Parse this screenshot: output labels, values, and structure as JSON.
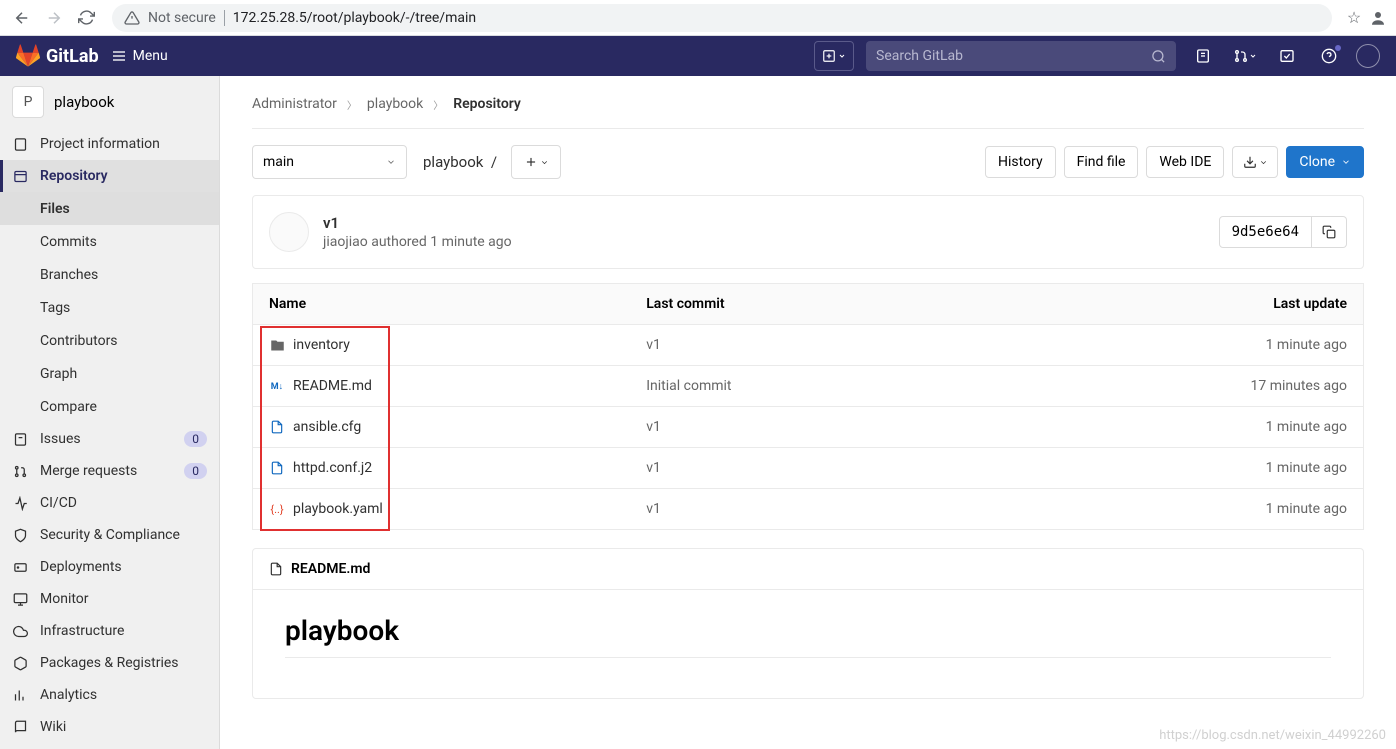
{
  "browser": {
    "not_secure": "Not secure",
    "url": "172.25.28.5/root/playbook/-/tree/main"
  },
  "header": {
    "brand": "GitLab",
    "menu": "Menu",
    "search_placeholder": "Search GitLab"
  },
  "sidebar": {
    "project_letter": "P",
    "project_name": "playbook",
    "items": [
      {
        "label": "Project information"
      },
      {
        "label": "Repository"
      },
      {
        "label": "Issues"
      },
      {
        "label": "Merge requests"
      },
      {
        "label": "CI/CD"
      },
      {
        "label": "Security & Compliance"
      },
      {
        "label": "Deployments"
      },
      {
        "label": "Monitor"
      },
      {
        "label": "Infrastructure"
      },
      {
        "label": "Packages & Registries"
      },
      {
        "label": "Analytics"
      },
      {
        "label": "Wiki"
      }
    ],
    "repo_sub": [
      "Files",
      "Commits",
      "Branches",
      "Tags",
      "Contributors",
      "Graph",
      "Compare"
    ],
    "issues_badge": "0",
    "mr_badge": "0"
  },
  "breadcrumb": {
    "a": "Administrator",
    "b": "playbook",
    "c": "Repository"
  },
  "tree": {
    "branch": "main",
    "path": "playbook",
    "sep": "/",
    "history": "History",
    "find": "Find file",
    "ide": "Web IDE",
    "clone": "Clone"
  },
  "commit": {
    "title": "v1",
    "author": "jiaojiao",
    "action": "authored",
    "time": "1 minute ago",
    "sha": "9d5e6e64"
  },
  "table": {
    "cols": [
      "Name",
      "Last commit",
      "Last update"
    ],
    "rows": [
      {
        "type": "folder",
        "name": "inventory",
        "commit": "v1",
        "update": "1 minute ago"
      },
      {
        "type": "md",
        "name": "README.md",
        "commit": "Initial commit",
        "update": "17 minutes ago"
      },
      {
        "type": "file",
        "name": "ansible.cfg",
        "commit": "v1",
        "update": "1 minute ago"
      },
      {
        "type": "file",
        "name": "httpd.conf.j2",
        "commit": "v1",
        "update": "1 minute ago"
      },
      {
        "type": "yaml",
        "name": "playbook.yaml",
        "commit": "v1",
        "update": "1 minute ago"
      }
    ]
  },
  "readme": {
    "filename": "README.md",
    "heading": "playbook"
  },
  "watermark": "https://blog.csdn.net/weixin_44992260"
}
